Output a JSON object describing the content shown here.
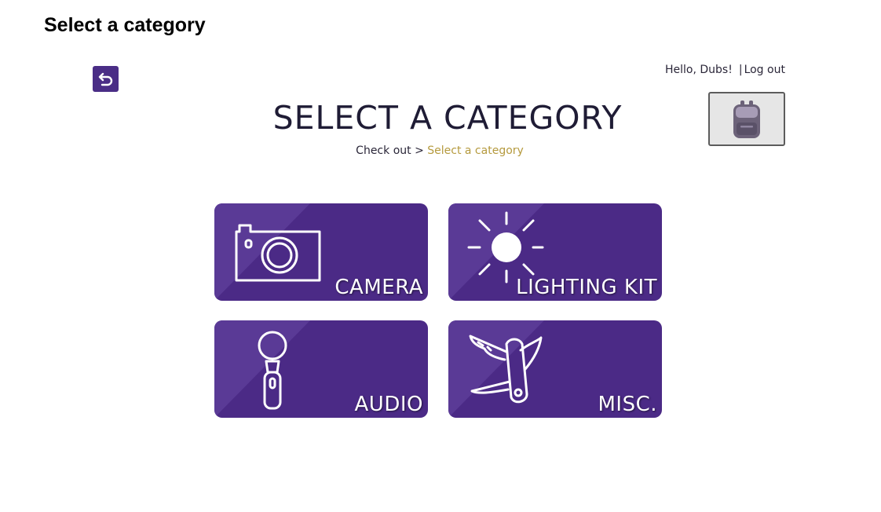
{
  "slide": {
    "title": "Select a category"
  },
  "header": {
    "greeting": "Hello, Dubs!",
    "separator": "|",
    "logout_label": "Log out",
    "heading": "SELECT A CATEGORY"
  },
  "breadcrumb": {
    "parent": "Check out",
    "divider": ">",
    "current": "Select a category"
  },
  "icons": {
    "back": "undo-arrow-icon",
    "backpack": "backpack-icon"
  },
  "categories": [
    {
      "label": "CAMERA",
      "icon": "camera-icon"
    },
    {
      "label": "LIGHTING KIT",
      "icon": "sun-icon"
    },
    {
      "label": "AUDIO",
      "icon": "microphone-icon"
    },
    {
      "label": "MISC.",
      "icon": "pocket-knife-icon"
    }
  ],
  "colors": {
    "tile_purple": "#4b2a86",
    "back_button": "#4a2d86",
    "breadcrumb_current": "#b59a3e"
  }
}
